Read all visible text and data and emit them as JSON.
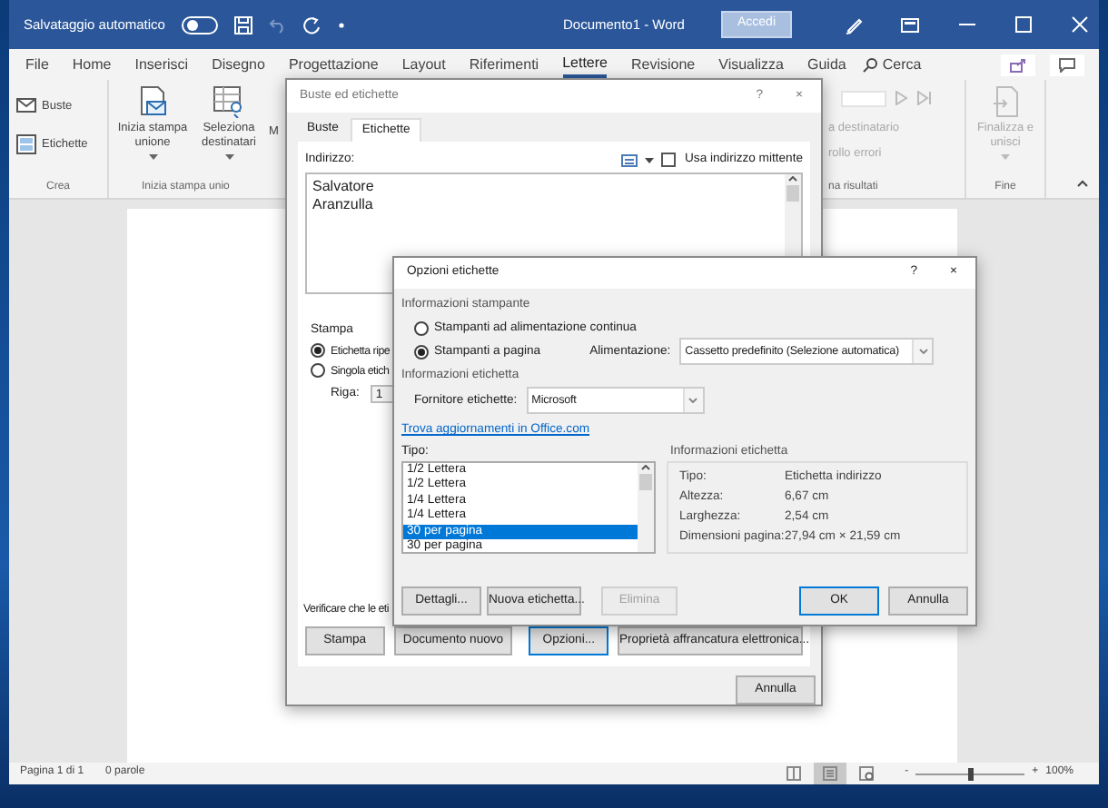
{
  "title_bar": {
    "autosave_label": "Salvataggio automatico",
    "autosave_on": false,
    "document_title": "Documento1 - Word",
    "signin": "Accedi"
  },
  "ribbon_tabs": [
    {
      "label": "File",
      "selected": false
    },
    {
      "label": "Home",
      "selected": false
    },
    {
      "label": "Inserisci",
      "selected": false
    },
    {
      "label": "Disegno",
      "selected": false
    },
    {
      "label": "Progettazione",
      "selected": false
    },
    {
      "label": "Layout",
      "selected": false
    },
    {
      "label": "Riferimenti",
      "selected": false
    },
    {
      "label": "Lettere",
      "selected": true
    },
    {
      "label": "Revisione",
      "selected": false
    },
    {
      "label": "Visualizza",
      "selected": false
    },
    {
      "label": "Guida",
      "selected": false
    }
  ],
  "search": {
    "label": "Cerca"
  },
  "ribbon": {
    "create_group": {
      "label": "Crea",
      "items": [
        "Buste",
        "Etichette"
      ]
    },
    "merge_group": {
      "label": "Inizia stampa unio",
      "items": [
        "Inizia stampa unione",
        "Seleziona destinatari"
      ],
      "partial": "M"
    },
    "results_group": {
      "label": "na risultati",
      "items": [
        {
          "label": "a destinatario",
          "disabled": true
        },
        {
          "label": "rollo errori",
          "disabled": true
        }
      ]
    },
    "finish_group": {
      "label": "Fine",
      "item": "Finalizza e unisci",
      "disabled": true
    }
  },
  "envelopes_dialog": {
    "title": "Buste ed etichette",
    "help": "?",
    "close": "×",
    "tabs": [
      {
        "label": "Buste",
        "selected": false
      },
      {
        "label": "Etichette",
        "selected": true
      }
    ],
    "address_label": "Indirizzo:",
    "use_sender": {
      "label": "Usa indirizzo mittente",
      "checked": false
    },
    "address_lines": [
      "Salvatore",
      "Aranzulla"
    ],
    "print_label": "Stampa",
    "print_options": [
      {
        "label": "Etichetta ripe",
        "selected": true
      },
      {
        "label": "Singola etich",
        "selected": false
      }
    ],
    "row_label": "Riga:",
    "row_value": "1",
    "verify_text": "Verificare che le eti",
    "buttons": [
      {
        "label": "Stampa",
        "focused": false
      },
      {
        "label": "Documento nuovo",
        "focused": false
      },
      {
        "label": "Opzioni...",
        "focused": true
      },
      {
        "label": "Proprietà affrancatura elettronica...",
        "focused": false
      }
    ],
    "cancel": "Annulla"
  },
  "options_dialog": {
    "title": "Opzioni etichette",
    "help": "?",
    "close": "×",
    "printer_section": "Informazioni stampante",
    "printer_types": [
      {
        "label": "Stampanti ad alimentazione continua",
        "selected": false
      },
      {
        "label": "Stampanti a pagina",
        "selected": true
      }
    ],
    "tray_label": "Alimentazione:",
    "tray_value": "Cassetto predefinito (Selezione automatica)",
    "label_section": "Informazioni etichetta",
    "vendor_label": "Fornitore etichette:",
    "vendor_value": "Microsoft",
    "update_link": "Trova aggiornamenti in Office.com",
    "type_label": "Tipo:",
    "types": [
      {
        "label": "1/2 Lettera",
        "selected": false
      },
      {
        "label": "1/2 Lettera",
        "selected": false
      },
      {
        "label": "1/4 Lettera",
        "selected": false
      },
      {
        "label": "1/4 Lettera",
        "selected": false
      },
      {
        "label": "30 per pagina",
        "selected": true
      },
      {
        "label": "30 per pagina",
        "selected": false
      }
    ],
    "info_title": "Informazioni etichetta",
    "info": [
      {
        "key": "Tipo:",
        "value": "Etichetta indirizzo"
      },
      {
        "key": "Altezza:",
        "value": "6,67 cm"
      },
      {
        "key": "Larghezza:",
        "value": "2,54 cm"
      },
      {
        "key": "Dimensioni pagina:",
        "value": "27,94 cm × 21,59 cm"
      }
    ],
    "left_buttons": [
      {
        "label": "Dettagli...",
        "disabled": false
      },
      {
        "label": "Nuova etichetta...",
        "disabled": false
      },
      {
        "label": "Elimina",
        "disabled": true
      }
    ],
    "right_buttons": [
      {
        "label": "OK",
        "default": true
      },
      {
        "label": "Annulla",
        "default": false
      }
    ]
  },
  "status_bar": {
    "page": "Pagina 1 di 1",
    "words": "0 parole",
    "view_modes": [
      {
        "kind": "read",
        "selected": false
      },
      {
        "kind": "print",
        "selected": true
      },
      {
        "kind": "web",
        "selected": false
      }
    ],
    "zoom_minus": "-",
    "zoom_plus": "+",
    "zoom": {
      "level": 0.5,
      "reading": "100%"
    }
  }
}
